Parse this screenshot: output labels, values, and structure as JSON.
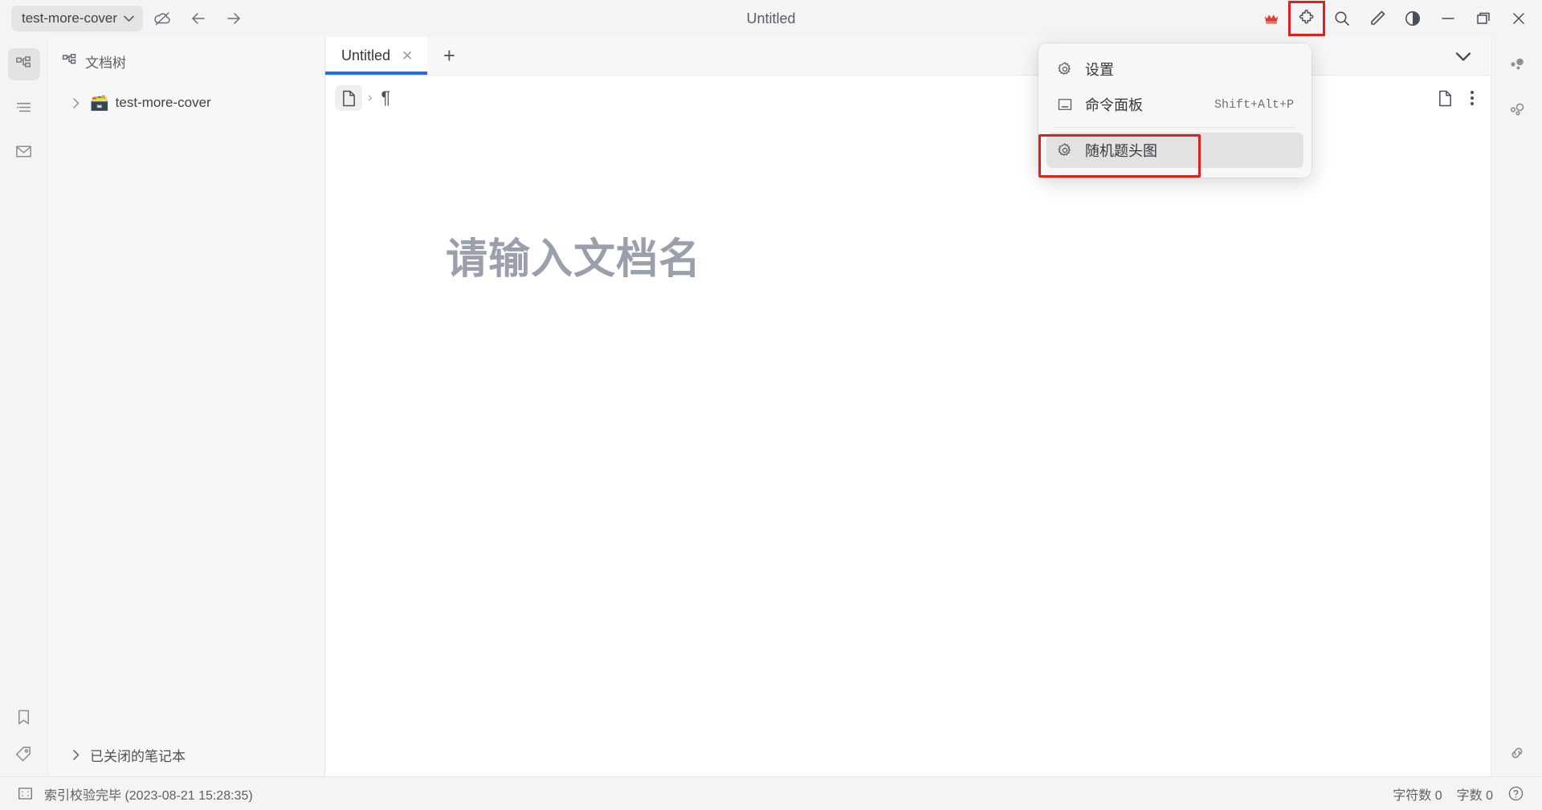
{
  "window": {
    "title": "Untitled",
    "workspace": "test-more-cover",
    "workspace_chevron": "chevron-down-icon",
    "sync_icon": "cloud-off-icon",
    "back_icon": "arrow-left-icon",
    "forward_icon": "arrow-right-icon",
    "controls": {
      "crown": "crown-icon",
      "plugins": "puzzle-icon",
      "search": "search-icon",
      "edit": "pencil-icon",
      "theme": "contrast-icon",
      "minimize": "minimize-icon",
      "maximize": "maximize-icon",
      "close": "close-icon"
    }
  },
  "left_dock": {
    "items": [
      {
        "name": "doc-tree",
        "icon": "tree-icon",
        "active": true
      },
      {
        "name": "outline",
        "icon": "outline-icon",
        "active": false
      },
      {
        "name": "inbox",
        "icon": "mail-icon",
        "active": false
      }
    ],
    "bottom_items": [
      {
        "name": "bookmark",
        "icon": "bookmark-icon"
      },
      {
        "name": "tag",
        "icon": "tag-icon"
      }
    ]
  },
  "file_tree": {
    "header": "文档树",
    "header_icon": "tree-icon",
    "notebooks": [
      {
        "label": "test-more-cover",
        "emoji": "🗃️",
        "expanded": false
      }
    ],
    "closed_notebooks_label": "已关闭的笔记本"
  },
  "editor": {
    "tab_label": "Untitled",
    "tab_close_icon": "close-icon",
    "new_tab_icon": "plus-icon",
    "tabbar_chevron_icon": "chevron-down-icon",
    "breadcrumb": {
      "doc_icon": "file-icon",
      "separator": "›",
      "pilcrow": "¶"
    },
    "toolbar_right": {
      "doc_icon": "file-icon",
      "more_icon": "more-vertical-icon"
    },
    "title_placeholder": "请输入文档名"
  },
  "right_dock": {
    "items": [
      {
        "name": "backlinks",
        "icon": "bubbles-filled-icon"
      },
      {
        "name": "graph",
        "icon": "bubbles-outline-icon"
      }
    ],
    "bottom_items": [
      {
        "name": "link",
        "icon": "link-icon"
      }
    ]
  },
  "menu": {
    "items": [
      {
        "label": "设置",
        "icon": "gear-icon",
        "accel": "",
        "hovered": false,
        "highlighted": false
      },
      {
        "label": "命令面板",
        "icon": "panel-icon",
        "accel": "Shift+Alt+P",
        "hovered": false,
        "highlighted": false
      },
      {
        "label": "随机题头图",
        "icon": "gear-icon",
        "accel": "",
        "hovered": true,
        "highlighted": true
      }
    ]
  },
  "status_bar": {
    "icon": "focus-icon",
    "message": "索引校验完毕 (2023-08-21 15:28:35)",
    "char_count_label": "字符数 0",
    "word_count_label": "字数 0",
    "help_icon": "help-circle-icon"
  },
  "colors": {
    "accent": "#1e6bf0",
    "annotation": "#e02020",
    "crown": "#e03a2f",
    "chrome": "#f4f4f4"
  }
}
